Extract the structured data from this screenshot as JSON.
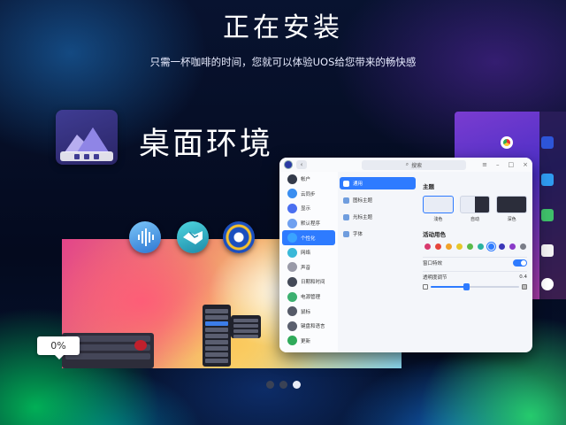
{
  "header": {
    "title": "正在安装",
    "subtitle": "只需一杯咖啡的时间，您就可以体验UOS给您带来的畅快感"
  },
  "feature": {
    "title": "桌面环境",
    "icon": "desktop-mountain-icon"
  },
  "progress": {
    "label": "0%",
    "value": 0
  },
  "app_icons": [
    "voice-assistant-icon",
    "handshake-icon",
    "device-manager-icon"
  ],
  "settings_window": {
    "search_placeholder": "搜索",
    "sidebar": [
      {
        "label": "帐户",
        "icon": "user-icon",
        "color": "#333a4a"
      },
      {
        "label": "云同步",
        "icon": "cloud-icon",
        "color": "#3a8ef0"
      },
      {
        "label": "显示",
        "icon": "display-icon",
        "color": "#4a6ff0"
      },
      {
        "label": "默认程序",
        "icon": "apps-icon",
        "color": "#6fa0f0"
      },
      {
        "label": "个性化",
        "icon": "palette-icon",
        "color": "#3aa3ff",
        "active": true
      },
      {
        "label": "网络",
        "icon": "network-icon",
        "color": "#3ab8d8"
      },
      {
        "label": "声音",
        "icon": "sound-icon",
        "color": "#999aa8"
      },
      {
        "label": "日期和时间",
        "icon": "clock-icon",
        "color": "#444a58"
      },
      {
        "label": "电源管理",
        "icon": "power-icon",
        "color": "#3cb070"
      },
      {
        "label": "鼠标",
        "icon": "mouse-icon",
        "color": "#555a68"
      },
      {
        "label": "键盘和语言",
        "icon": "keyboard-icon",
        "color": "#5a5f6e"
      },
      {
        "label": "更新",
        "icon": "update-icon",
        "color": "#2faa5a"
      }
    ],
    "middle": [
      {
        "label": "通用",
        "active": true
      },
      {
        "label": "图标主题"
      },
      {
        "label": "光标主题"
      },
      {
        "label": "字体"
      }
    ],
    "theme": {
      "heading": "主题",
      "options": [
        {
          "label": "浅色",
          "selected": true,
          "style": "light"
        },
        {
          "label": "自动",
          "style": "auto"
        },
        {
          "label": "深色",
          "style": "dark"
        }
      ]
    },
    "accent": {
      "heading": "活动用色",
      "colors": [
        "#d83a6e",
        "#e6463b",
        "#f0a22a",
        "#e6c72a",
        "#5aba4a",
        "#2ab3a0",
        "#2e7bff",
        "#3b37b8",
        "#8a3ac8",
        "#7a7d88"
      ],
      "selected_index": 6
    },
    "window_effect": {
      "label": "窗口特效",
      "enabled": true
    },
    "transparency": {
      "label": "透明度调节",
      "value": 0.4,
      "value_text": "0.4"
    }
  },
  "carousel": {
    "count": 3,
    "active_index": 2
  }
}
